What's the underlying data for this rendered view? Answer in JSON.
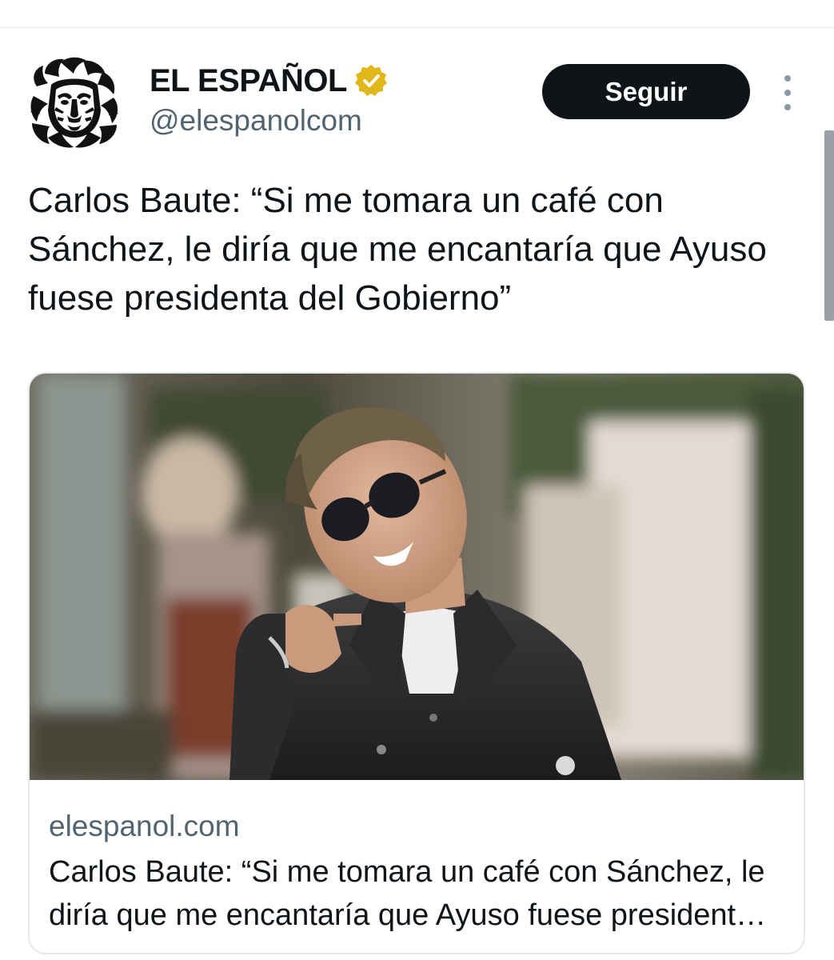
{
  "account": {
    "display_name": "EL ESPAÑOL",
    "handle": "@elespanolcom",
    "verified": true,
    "avatar_icon": "lion-logo-icon",
    "verified_icon": "verified-badge-icon",
    "verified_color": "#e2b719"
  },
  "actions": {
    "follow_label": "Seguir",
    "more_icon": "more-vertical-icon"
  },
  "tweet": {
    "text": "Carlos Baute: “Si me tomara un café con Sánchez, le diría que me encantaría que Ayuso fuese presidenta del Gobierno”"
  },
  "link_card": {
    "image_icon": "article-photo",
    "domain": "elespanol.com",
    "title": "Carlos Baute: “Si me tomara un café con Sánchez, le diría que me encantaría que Ayuso fuese presidenta del Gobierno”"
  },
  "colors": {
    "text_primary": "#0f1419",
    "text_secondary": "#536471",
    "border": "#e6e9ec",
    "follow_bg": "#0f1419"
  }
}
